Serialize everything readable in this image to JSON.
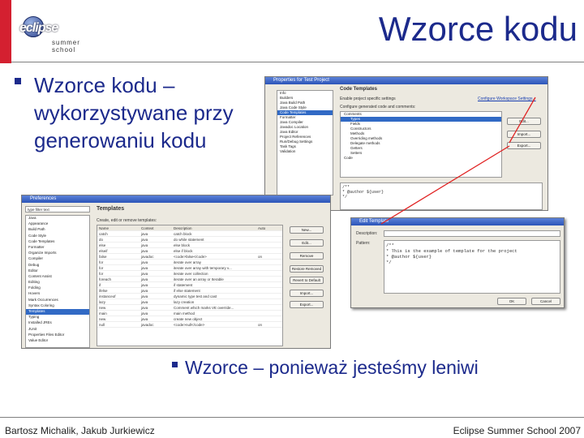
{
  "slide": {
    "title": "Wzorce kodu",
    "bullet_main": "Wzorce kodu –",
    "bullet_main_line2": "wykorzystywane przy",
    "bullet_main_line3": "generowaniu kodu",
    "bullet_second": "Wzorce – ponieważ jesteśmy leniwi",
    "footer_left": "Bartosz Michalik, Jakub Jurkiewicz",
    "footer_right": "Eclipse Summer School 2007",
    "logo_text": "eclipse",
    "logo_subtext": "summer school"
  },
  "colors": {
    "accent": "#1c2a8c",
    "red_bar": "#d42030",
    "arrow": "#e02020"
  },
  "prefs_window": {
    "title": "Preferences",
    "filter_placeholder": "type filter text",
    "section_title": "Templates",
    "subtitle": "Create, edit or remove templates:",
    "tree": [
      "Java",
      "Appearance",
      "Build Path",
      "Code Style",
      "Code Templates",
      "Formatter",
      "Organize Imports",
      "Compiler",
      "Debug",
      "Editor",
      "Content Assist",
      "Editing",
      "Folding",
      "Hovers",
      "Mark Occurrences",
      "Syntax Coloring",
      "Templates",
      "Typing",
      "Installed JREs",
      "JUnit",
      "Properties Files Editor",
      "Value Editor"
    ],
    "columns": [
      "Name",
      "Context",
      "Description",
      "Auto"
    ],
    "rows": [
      [
        "catch",
        "java",
        "catch block",
        ""
      ],
      [
        "do",
        "java",
        "do while statement",
        ""
      ],
      [
        "else",
        "java",
        "else block",
        ""
      ],
      [
        "elseif",
        "java",
        "else if block",
        ""
      ],
      [
        "false",
        "javadoc",
        "<code>false</code>",
        "on"
      ],
      [
        "for",
        "java",
        "iterate over array",
        ""
      ],
      [
        "for",
        "java",
        "iterate over array with temporary v...",
        ""
      ],
      [
        "for",
        "java",
        "iterate over collection",
        ""
      ],
      [
        "foreach",
        "java",
        "iterate over an array or Iterable",
        ""
      ],
      [
        "if",
        "java",
        "if statement",
        ""
      ],
      [
        "ifelse",
        "java",
        "if else statement",
        ""
      ],
      [
        "instanceof",
        "java",
        "dynamic type test and cast",
        ""
      ],
      [
        "lazy",
        "java",
        "lazy creation",
        ""
      ],
      [
        "new",
        "java",
        "Comment which marks VE override...",
        ""
      ],
      [
        "main",
        "java",
        "main method",
        ""
      ],
      [
        "new",
        "java",
        "create new object",
        ""
      ],
      [
        "null",
        "javadoc",
        "<code>null</code>",
        "on"
      ]
    ],
    "buttons": [
      "New...",
      "Edit...",
      "Remove",
      "Restore Removed",
      "Revert to Default",
      "Import...",
      "Export..."
    ]
  },
  "project_window": {
    "title": "Properties for Test Project",
    "section_title": "Code Templates",
    "checkbox": "Enable project specific settings",
    "link": "Configure Workspace Settings...",
    "tree": [
      "Info",
      "Builders",
      "Java Build Path",
      "Java Code Style",
      "Code Templates",
      "Formatter",
      "Java Compiler",
      "Javadoc Location",
      "Java Editor",
      "Project References",
      "Run/Debug Settings",
      "Task Tags",
      "Validation"
    ],
    "patterns_label": "Configure generated code and comments:",
    "patterns": [
      "Comments",
      "Types",
      "Fields",
      "Constructors",
      "Methods",
      "Overriding methods",
      "Delegate methods",
      "Getters",
      "Setters",
      "Code"
    ],
    "buttons": [
      "Edit...",
      "Import...",
      "Export..."
    ],
    "pattern_preview": [
      "/**",
      "* @author ${user}",
      "*/"
    ]
  },
  "edit_dialog": {
    "title": "Edit Template",
    "desc_label": "Description:",
    "pattern_label": "Pattern:",
    "pattern_lines": [
      "/**",
      "* This is the example of template for the project",
      "* @author ${user}",
      "*/"
    ],
    "ok": "OK",
    "cancel": "Cancel"
  }
}
